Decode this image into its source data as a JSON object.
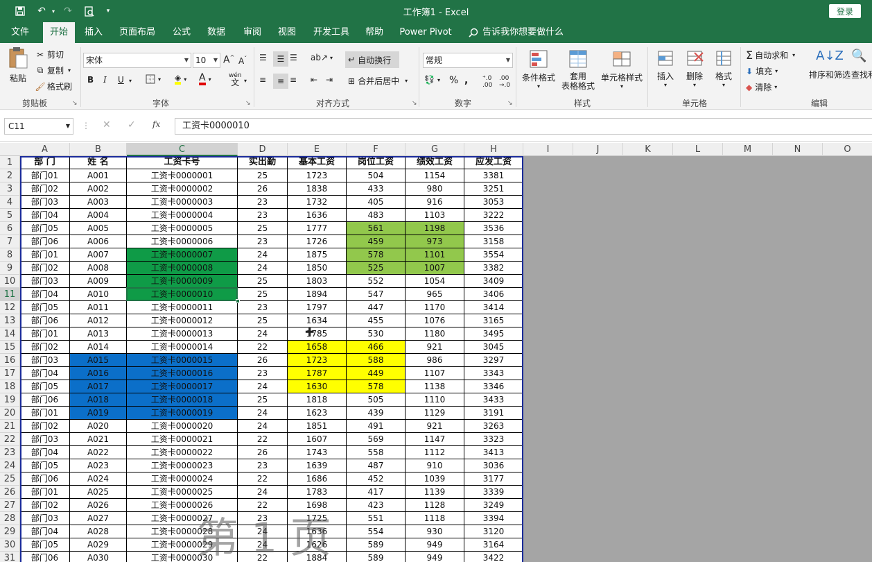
{
  "window": {
    "title": "工作簿1  -  Excel",
    "login_label": "登录"
  },
  "tabs": [
    {
      "label": "文件"
    },
    {
      "label": "开始"
    },
    {
      "label": "插入"
    },
    {
      "label": "页面布局"
    },
    {
      "label": "公式"
    },
    {
      "label": "数据"
    },
    {
      "label": "审阅"
    },
    {
      "label": "视图"
    },
    {
      "label": "开发工具"
    },
    {
      "label": "帮助"
    },
    {
      "label": "Power Pivot"
    }
  ],
  "active_tab": "开始",
  "tellme": "告诉我你想要做什么",
  "ribbon": {
    "clipboard": {
      "paste": "粘贴",
      "cut": "剪切",
      "copy": "复制",
      "format_painter": "格式刷",
      "label": "剪贴板"
    },
    "font": {
      "name": "宋体",
      "size": "10",
      "bold": "B",
      "italic": "I",
      "underline": "U",
      "wen": "wén",
      "label": "字体"
    },
    "alignment": {
      "wrap": "自动换行",
      "merge": "合并后居中",
      "label": "对齐方式"
    },
    "number": {
      "format": "常规",
      "percent": "%",
      "label": "数字"
    },
    "styles": {
      "cond": "条件格式",
      "table_1": "套用",
      "table_2": "表格格式",
      "cell_style": "单元格样式",
      "label": "样式"
    },
    "cells": {
      "insert": "插入",
      "delete": "删除",
      "format": "格式",
      "label": "单元格"
    },
    "editing": {
      "autosum": "自动求和",
      "fill": "填充",
      "clear": "清除",
      "sort": "排序和筛选",
      "find": "查找和选择",
      "label": "编辑"
    }
  },
  "formula_bar": {
    "name_box": "C11",
    "fx": "fx",
    "content": "工资卡0000010"
  },
  "columns": [
    "A",
    "B",
    "C",
    "D",
    "E",
    "F",
    "G",
    "H",
    "I",
    "J",
    "K",
    "L",
    "M",
    "N",
    "O"
  ],
  "headers": [
    "部  门",
    "姓  名",
    "工资卡号",
    "实出勤",
    "基本工资",
    "岗位工资",
    "绩效工资",
    "应发工资"
  ],
  "rows": [
    [
      "部门01",
      "A001",
      "工资卡0000001",
      "25",
      "1723",
      "504",
      "1154",
      "3381"
    ],
    [
      "部门02",
      "A002",
      "工资卡0000002",
      "26",
      "1838",
      "433",
      "980",
      "3251"
    ],
    [
      "部门03",
      "A003",
      "工资卡0000003",
      "23",
      "1732",
      "405",
      "916",
      "3053"
    ],
    [
      "部门04",
      "A004",
      "工资卡0000004",
      "23",
      "1636",
      "483",
      "1103",
      "3222"
    ],
    [
      "部门05",
      "A005",
      "工资卡0000005",
      "25",
      "1777",
      "561",
      "1198",
      "3536"
    ],
    [
      "部门06",
      "A006",
      "工资卡0000006",
      "23",
      "1726",
      "459",
      "973",
      "3158"
    ],
    [
      "部门01",
      "A007",
      "工资卡0000007",
      "24",
      "1875",
      "578",
      "1101",
      "3554"
    ],
    [
      "部门02",
      "A008",
      "工资卡0000008",
      "24",
      "1850",
      "525",
      "1007",
      "3382"
    ],
    [
      "部门03",
      "A009",
      "工资卡0000009",
      "25",
      "1803",
      "552",
      "1054",
      "3409"
    ],
    [
      "部门04",
      "A010",
      "工资卡0000010",
      "25",
      "1894",
      "547",
      "965",
      "3406"
    ],
    [
      "部门05",
      "A011",
      "工资卡0000011",
      "23",
      "1797",
      "447",
      "1170",
      "3414"
    ],
    [
      "部门06",
      "A012",
      "工资卡0000012",
      "25",
      "1634",
      "455",
      "1076",
      "3165"
    ],
    [
      "部门01",
      "A013",
      "工资卡0000013",
      "24",
      "1785",
      "530",
      "1180",
      "3495"
    ],
    [
      "部门02",
      "A014",
      "工资卡0000014",
      "22",
      "1658",
      "466",
      "921",
      "3045"
    ],
    [
      "部门03",
      "A015",
      "工资卡0000015",
      "26",
      "1723",
      "588",
      "986",
      "3297"
    ],
    [
      "部门04",
      "A016",
      "工资卡0000016",
      "23",
      "1787",
      "449",
      "1107",
      "3343"
    ],
    [
      "部门05",
      "A017",
      "工资卡0000017",
      "24",
      "1630",
      "578",
      "1138",
      "3346"
    ],
    [
      "部门06",
      "A018",
      "工资卡0000018",
      "25",
      "1818",
      "505",
      "1110",
      "3433"
    ],
    [
      "部门01",
      "A019",
      "工资卡0000019",
      "24",
      "1623",
      "439",
      "1129",
      "3191"
    ],
    [
      "部门02",
      "A020",
      "工资卡0000020",
      "24",
      "1851",
      "491",
      "921",
      "3263"
    ],
    [
      "部门03",
      "A021",
      "工资卡0000021",
      "22",
      "1607",
      "569",
      "1147",
      "3323"
    ],
    [
      "部门04",
      "A022",
      "工资卡0000022",
      "26",
      "1743",
      "558",
      "1112",
      "3413"
    ],
    [
      "部门05",
      "A023",
      "工资卡0000023",
      "23",
      "1639",
      "487",
      "910",
      "3036"
    ],
    [
      "部门06",
      "A024",
      "工资卡0000024",
      "22",
      "1686",
      "452",
      "1039",
      "3177"
    ],
    [
      "部门01",
      "A025",
      "工资卡0000025",
      "24",
      "1783",
      "417",
      "1139",
      "3339"
    ],
    [
      "部门02",
      "A026",
      "工资卡0000026",
      "22",
      "1698",
      "423",
      "1128",
      "3249"
    ],
    [
      "部门03",
      "A027",
      "工资卡0000027",
      "23",
      "1725",
      "551",
      "1118",
      "3394"
    ],
    [
      "部门04",
      "A028",
      "工资卡0000028",
      "24",
      "1636",
      "554",
      "930",
      "3120"
    ],
    [
      "部门05",
      "A029",
      "工资卡0000029",
      "24",
      "1626",
      "589",
      "949",
      "3164"
    ],
    [
      "部门06",
      "A030",
      "工资卡0000030",
      "22",
      "1884",
      "589",
      "949",
      "3422"
    ]
  ],
  "highlights": {
    "green": {
      "color": "#0f9b47",
      "col": 2,
      "rows": [
        7,
        8,
        9,
        10
      ]
    },
    "light_green": {
      "color": "#92c84c",
      "cols": [
        5,
        6
      ],
      "rows": [
        5,
        6,
        7,
        8
      ]
    },
    "yellow": {
      "color": "#ffff00",
      "cols": [
        4,
        5
      ],
      "rows": [
        14,
        15,
        16,
        17
      ]
    },
    "blue": {
      "color": "#0b6fc9",
      "cols": [
        1,
        2
      ],
      "rows": [
        15,
        16,
        17,
        18,
        19
      ]
    }
  },
  "active_cell": {
    "ref": "C11",
    "col": 2,
    "row": 10
  },
  "watermark": "第1页",
  "accent_color": "#217346"
}
